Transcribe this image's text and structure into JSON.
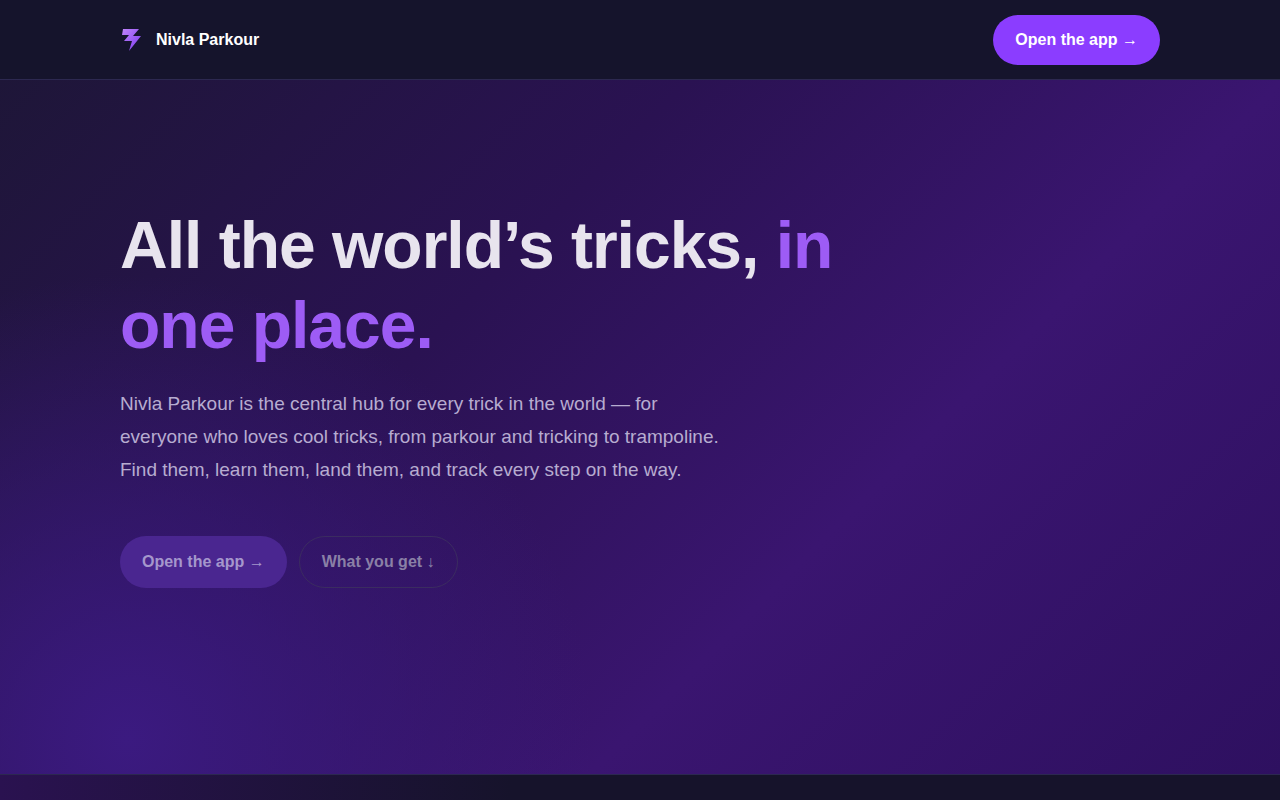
{
  "header": {
    "brand": "Nivla Parkour",
    "cta": "Open the app →"
  },
  "hero": {
    "heading": {
      "text": "All the world’s tricks, ",
      "accent": "in one place."
    },
    "description": "Nivla Parkour is the central hub for every trick in the world — for everyone who loves cool tricks, from parkour and tricking to trampoline. Find them, learn them, land them, and track every step on the way.",
    "buttons": [
      {
        "label": "Open the app →",
        "kind": "primary"
      },
      {
        "label": "What you get ↓",
        "kind": "secondary"
      }
    ]
  }
}
